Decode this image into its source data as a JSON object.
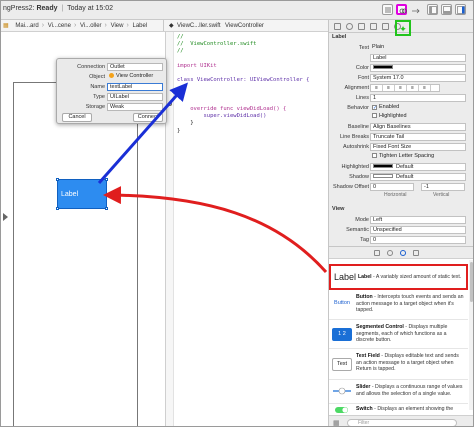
{
  "toolbar": {
    "project": "ngPress2:",
    "state": "Ready",
    "time": "Today at 15:02"
  },
  "jumpbar": {
    "left": [
      "Mai...ard",
      "Vi...cene",
      "Vi...oller",
      "View",
      "Label"
    ],
    "right": [
      "ViewC...ller.swift",
      "ViewController"
    ]
  },
  "popup": {
    "connection_label": "Connection",
    "connection_value": "Outlet",
    "object_label": "Object",
    "object_value": "View Controller",
    "name_label": "Name",
    "name_value": "textLabel",
    "type_label": "Type",
    "type_value": "UILabel",
    "storage_label": "Storage",
    "storage_value": "Weak",
    "cancel": "Cancel",
    "connect": "Connect"
  },
  "code": {
    "lines": [
      "//",
      "//  ViewController.swift",
      "//",
      "",
      "import UIKit",
      "",
      "class ViewController: UIViewController {",
      "",
      "",
      "",
      "    override func viewDidLoad() {",
      "        super.viewDidLoad()",
      "    }",
      "}"
    ]
  },
  "canvas": {
    "label_text": "Label"
  },
  "inspector": {
    "section_label": "Label",
    "text_label": "Text",
    "text_value": "Plain",
    "text_content": "Label",
    "color_label": "Color",
    "font_label": "Font",
    "font_value": "System 17.0",
    "alignment_label": "Alignment",
    "lines_label": "Lines",
    "lines_value": "1",
    "behavior_label": "Behavior",
    "enabled": "Enabled",
    "highlighted": "Highlighted",
    "baseline_label": "Baseline",
    "baseline_value": "Align Baselines",
    "line_breaks_label": "Line Breaks",
    "line_breaks_value": "Truncate Tail",
    "autoshrink_label": "Autoshrink",
    "autoshrink_value": "Fixed Font Size",
    "tighten": "Tighten Letter Spacing",
    "highlighted_label": "Highlighted",
    "highlighted_value": "Default",
    "shadow_label": "Shadow",
    "shadow_value": "Default",
    "shadow_offset_label": "Shadow Offset",
    "shadow_offset_h": "0",
    "shadow_offset_v": "-1",
    "horizontal": "Horizontal",
    "vertical": "Vertical",
    "view_section": "View",
    "mode_label": "Mode",
    "mode_value": "Left",
    "semantic_label": "Semantic",
    "semantic_value": "Unspecified",
    "tag_label": "Tag",
    "tag_value": "0"
  },
  "library": {
    "items": [
      {
        "icon": "Label",
        "title": "Label",
        "desc": "- A variably sized amount of static text."
      },
      {
        "icon": "Button",
        "title": "Button",
        "desc": "- Intercepts touch events and sends an action message to a target object when it's tapped."
      },
      {
        "icon": "1 2",
        "title": "Segmented Control",
        "desc": "- Displays multiple segments, each of which functions as a discrete button."
      },
      {
        "icon": "Text",
        "title": "Text Field",
        "desc": "- Displays editable text and sends an action message to a target object when Return is tapped."
      },
      {
        "icon": "",
        "title": "Slider",
        "desc": "- Displays a continuous range of values and allows the selection of a single value."
      },
      {
        "icon": "",
        "title": "Switch",
        "desc": "- Displays an element showing the"
      }
    ],
    "filter_placeholder": "Filter"
  },
  "annotations": {
    "blue_arrow_color": "#1a2fd6",
    "red_arrow_color": "#e01e1e",
    "highlight_magenta": "#e000e0",
    "highlight_green": "#22c41c"
  }
}
